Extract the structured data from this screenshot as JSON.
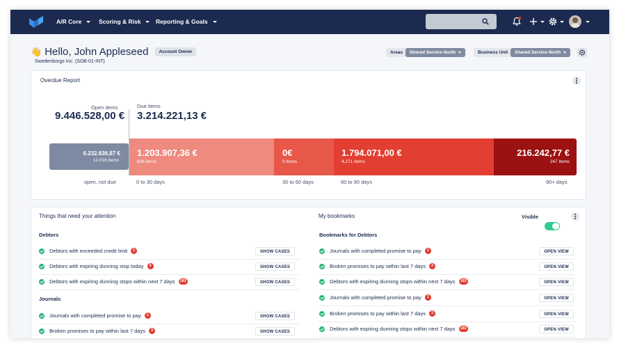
{
  "nav": {
    "items": [
      {
        "label": "A/R Core"
      },
      {
        "label": "Scoring & Risk"
      },
      {
        "label": "Reporting & Goals"
      }
    ]
  },
  "header": {
    "greeting_emoji": "👋",
    "greeting": "Hello, John Appleseed",
    "role_badge": "Account Owner",
    "company": "Swedenborgs Inc. (SDB-01-INT)",
    "areas_label": "Areas",
    "areas_value": "Shared Service North",
    "business_unit_label": "Business Unit",
    "business_unit_value": "Shared Service North"
  },
  "overdue": {
    "title": "Overdue Report",
    "open_items_label": "Open items",
    "open_items_value": "9.446.528,00 €",
    "due_items_label": "Due items",
    "due_items_value": "3.214.221,13 €",
    "not_due": {
      "amount": "6.232.636,87 €",
      "count": "12.016 items",
      "label": "open, not due"
    },
    "buckets": [
      {
        "amount": "1.203.907,36 €",
        "count": "826 items",
        "label": "0 to 30 days",
        "color": "#ee8a7e"
      },
      {
        "amount": "0€",
        "count": "0 items",
        "label": "30 to 60 days",
        "color": "#e8584a"
      },
      {
        "amount": "1.794.071,00 €",
        "count": "4.271 items",
        "label": "60 to 90 days",
        "color": "#e23e32"
      },
      {
        "amount": "216.242,77 €",
        "count": "247 items",
        "label": "90+ days",
        "color": "#9c1111"
      }
    ]
  },
  "attention": {
    "title": "Things that need your attention",
    "debtors_heading": "Debtors",
    "journals_heading": "Journals",
    "button_label": "SHOW CASES",
    "debtors": [
      {
        "text": "Debtors with exceeded credit limit",
        "count": "1"
      },
      {
        "text": "Debtors with expiring dunning stop today",
        "count": "3"
      },
      {
        "text": "Debtors with expiring dunning stops within next 7 days",
        "count": "183"
      }
    ],
    "journals": [
      {
        "text": "Journals with completed promise to pay",
        "count": "1"
      },
      {
        "text": "Broken promises to pay within last 7 days",
        "count": "3"
      }
    ]
  },
  "bookmarks": {
    "title": "My bookmarks",
    "visible_label": "Visible",
    "heading": "Bookmarks for Debtors",
    "button_label": "OPEN VIEW",
    "items": [
      {
        "text": "Journals with completed promise to pay",
        "count": "1"
      },
      {
        "text": "Broken promises to pay within last 7 days",
        "count": "3"
      },
      {
        "text": "Debtors with expiring dunning stops within next 7 days",
        "count": "183"
      },
      {
        "text": "Journals with completed promise to pay",
        "count": "1"
      },
      {
        "text": "Broken promises to pay within last 7 days",
        "count": "3"
      },
      {
        "text": "Debtors with expiring dunning stops within next 7 days",
        "count": "183"
      }
    ]
  }
}
